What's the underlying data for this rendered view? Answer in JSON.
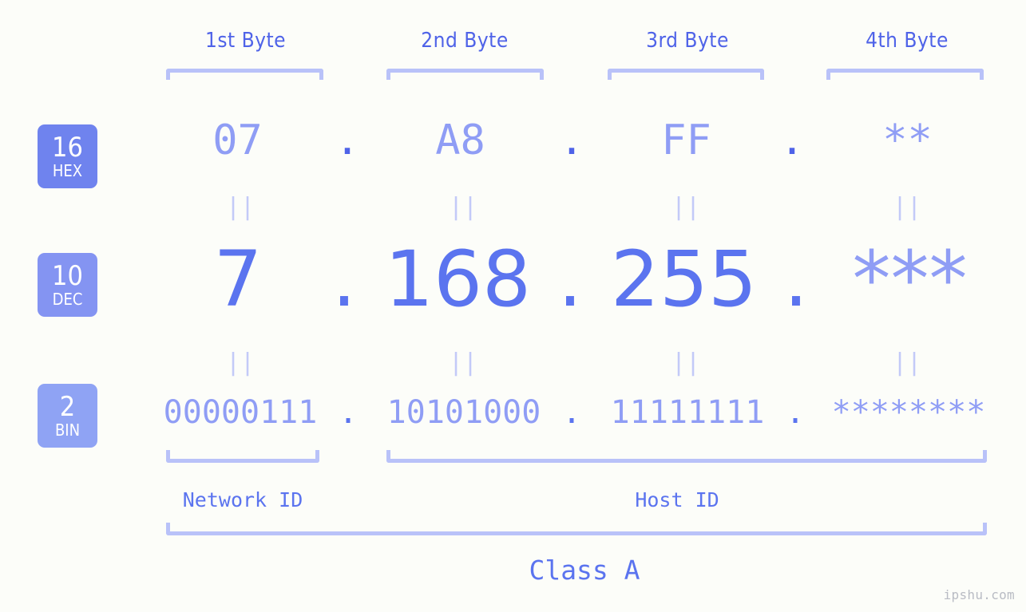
{
  "page": {
    "background_color": "#fcfdf9",
    "accent_color": "#5b74ef",
    "light_accent_color": "#8f9df5",
    "bracket_color": "#b9c2f9",
    "watermark": "ipshu.com"
  },
  "byte_headers": [
    {
      "label": "1st Byte"
    },
    {
      "label": "2nd Byte"
    },
    {
      "label": "3rd Byte"
    },
    {
      "label": "4th Byte"
    }
  ],
  "bases": [
    {
      "number": "16",
      "unit": "HEX",
      "color": "#6f83ee"
    },
    {
      "number": "10",
      "unit": "DEC",
      "color": "#8494f2"
    },
    {
      "number": "2",
      "unit": "BIN",
      "color": "#8fa3f4"
    }
  ],
  "rows": {
    "hex": {
      "octets": [
        "07",
        "A8",
        "FF",
        "**"
      ],
      "separator": "."
    },
    "dec": {
      "octets": [
        "7",
        "168",
        "255",
        "***"
      ],
      "separator": "."
    },
    "bin": {
      "octets": [
        "00000111",
        "10101000",
        "11111111",
        "********"
      ],
      "separator": "."
    }
  },
  "equals_marks": {
    "symbol": "||",
    "count_per_gap": 4,
    "gaps": 2
  },
  "id_sections": [
    {
      "label": "Network ID"
    },
    {
      "label": "Host ID"
    }
  ],
  "class": {
    "label": "Class A"
  }
}
